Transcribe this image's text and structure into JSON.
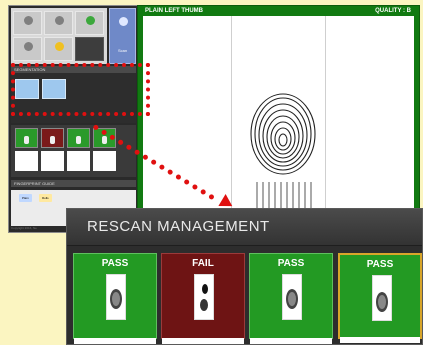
{
  "left_panel": {
    "toolbar_buttons": [
      "",
      "",
      "",
      "",
      "",
      ""
    ],
    "scan_button_label": "Scan",
    "segment_header": "SEGMENTATION",
    "segment_buttons": [
      "",
      ""
    ],
    "rescan_cards": [
      "pass",
      "fail",
      "pass",
      "pass"
    ],
    "guide_header": "FINGERPRINT GUIDE",
    "guide_chips": [
      "Plain",
      "Rolls"
    ],
    "copyright": "Copyright 2016, Ne"
  },
  "viewer": {
    "title": "PLAIN LEFT THUMB",
    "quality": "QUALITY : B"
  },
  "rescan": {
    "title": "RESCAN MANAGEMENT",
    "cards": [
      {
        "label": "PASS",
        "status": "pass"
      },
      {
        "label": "FAIL",
        "status": "fail"
      },
      {
        "label": "PASS",
        "status": "pass"
      },
      {
        "label": "PASS",
        "status": "pass",
        "selected": true
      }
    ]
  },
  "colors": {
    "background": "#fbf5c1",
    "pass_green": "#239a23",
    "fail_red": "#6e1414",
    "highlight_red": "#e01010",
    "viewer_green": "#117a11"
  }
}
